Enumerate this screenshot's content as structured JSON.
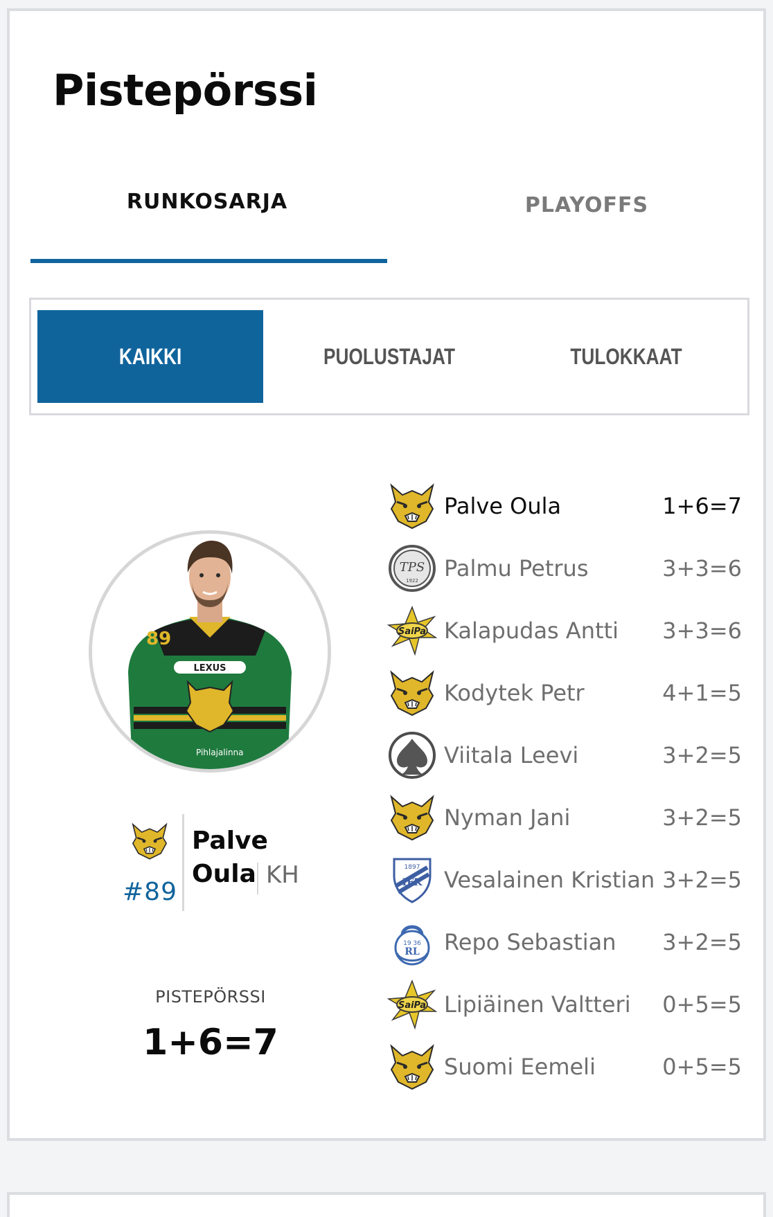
{
  "page": {
    "title": "Pistepörssi"
  },
  "tabs": [
    {
      "label": "RUNKOSARJA",
      "active": true
    },
    {
      "label": "PLAYOFFS",
      "active": false
    }
  ],
  "filters": [
    {
      "label": "KAIKKI",
      "active": true
    },
    {
      "label": "PUOLUSTAJAT",
      "active": false
    },
    {
      "label": "TULOKKAAT",
      "active": false
    }
  ],
  "featured": {
    "first_name": "Palve",
    "last_name": "Oula",
    "number": "#89",
    "position": "KH",
    "team_icon": "lynx-icon",
    "stat_label": "PISTEPÖRSSI",
    "stat_value": "1+6=7"
  },
  "players": [
    {
      "name": "Palve Oula",
      "points": "1+6=7",
      "team_icon": "lynx-icon"
    },
    {
      "name": "Palmu Petrus",
      "points": "3+3=6",
      "team_icon": "tps-icon"
    },
    {
      "name": "Kalapudas Antti",
      "points": "3+3=6",
      "team_icon": "saipa-icon"
    },
    {
      "name": "Kodytek Petr",
      "points": "4+1=5",
      "team_icon": "lynx-icon"
    },
    {
      "name": "Viitala Leevi",
      "points": "3+2=5",
      "team_icon": "spade-icon"
    },
    {
      "name": "Nyman Jani",
      "points": "3+2=5",
      "team_icon": "lynx-icon"
    },
    {
      "name": "Vesalainen Kristian",
      "points": "3+2=5",
      "team_icon": "ifk-icon"
    },
    {
      "name": "Repo Sebastian",
      "points": "3+2=5",
      "team_icon": "lukko-icon"
    },
    {
      "name": "Lipiäinen Valtteri",
      "points": "0+5=5",
      "team_icon": "saipa-icon"
    },
    {
      "name": "Suomi Eemeli",
      "points": "0+5=5",
      "team_icon": "lynx-icon"
    }
  ],
  "colors": {
    "accent": "#10649c",
    "text": "#0b0b0b",
    "muted": "#6e6e6e"
  }
}
